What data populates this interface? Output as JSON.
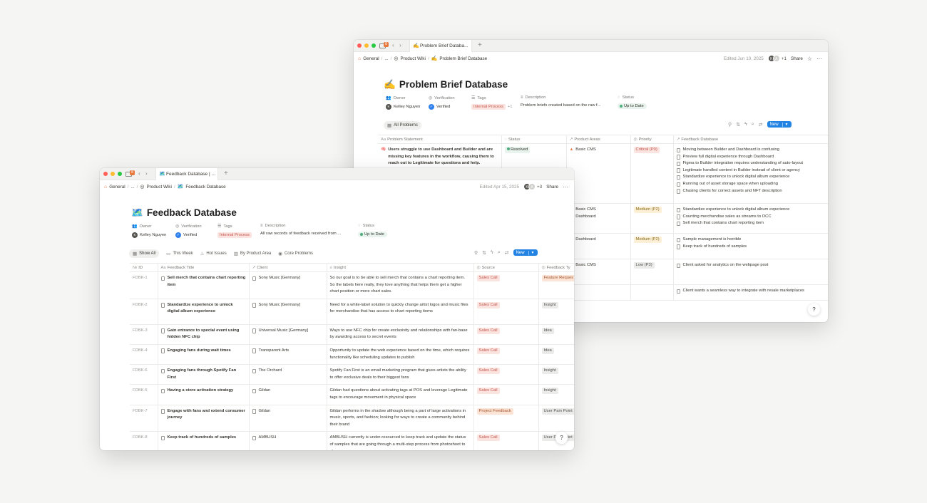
{
  "back_window": {
    "tab_title": "Problem Brief Databa...",
    "tab_icon": "✍️",
    "notification_count": "8",
    "breadcrumbs": [
      "General",
      "...",
      "Product Wiki",
      "Problem Brief Database"
    ],
    "edited": "Edited Jun 10, 2025",
    "avatars": [
      "K",
      "A"
    ],
    "avatars_more": "+1",
    "share_label": "Share",
    "page_title": "Problem Brief Database",
    "page_title_icon": "✍️",
    "properties": {
      "owner_label": "Owner",
      "owner_value": "Kelley Nguyen",
      "owner_initial": "K",
      "verification_label": "Verification",
      "verification_value": "Verified",
      "tags_label": "Tags",
      "tags_value": "Internal Process",
      "tags_more": "+1",
      "description_label": "Description",
      "description_value": "Problem briefs created based on the raw f...",
      "status_label": "Status",
      "status_value": "Up to Date"
    },
    "views": [
      "All Problems"
    ],
    "new_label": "New",
    "columns": [
      "Problem Statement",
      "Status",
      "Product Areas",
      "Priority",
      "Feedback Database"
    ],
    "rows": [
      {
        "statement": "Users struggle to use Dashboard and Builder and are missing key features in the workflow, causing them to reach out to Legitimate for questions and help.",
        "status": "Resolved",
        "areas": [
          "Basic CMS"
        ],
        "priority": "Critical (P0)",
        "feedback": [
          "Moving between Builder and Dashboard is confusing",
          "Preview full digital experience through Dashboard",
          "Figma to Builder integration requires understanding of auto-layout",
          "Legitimate handled content in Builder instead of client or agency",
          "Standardize experience to unlock digital album experience",
          "Running out of asset storage space when uploading",
          "Chasing clients for correct assets and NFT description"
        ]
      },
      {
        "statement": "",
        "status": "",
        "areas": [
          "Basic CMS",
          "Dashboard"
        ],
        "priority": "Medium (P2)",
        "feedback": [
          "Standardize experience to unlock digital album experience",
          "Counting merchandise sales as streams to OCC",
          "Sell merch that contains chart reporting item"
        ]
      },
      {
        "statement": "",
        "status": "",
        "areas": [
          "Dashboard"
        ],
        "priority": "Medium (P2)",
        "feedback": [
          "Sample management is horrible",
          "Keep track of hundreds of samples"
        ]
      },
      {
        "statement": "",
        "status": "",
        "areas": [
          "Basic CMS"
        ],
        "priority": "Low (P3)",
        "feedback": [
          "Client asked for analytics on the webpage post"
        ]
      },
      {
        "statement": "",
        "status": "",
        "areas": [],
        "priority": "",
        "feedback": [
          "Client wants a seamless way to integrate with resale marketplaces"
        ]
      }
    ]
  },
  "front_window": {
    "tab_title": "Feedback Database | ...",
    "tab_icon": "🗺️",
    "notification_count": "8",
    "breadcrumbs": [
      "General",
      "...",
      "Product Wiki",
      "Feedback Database"
    ],
    "edited": "Edited Apr 15, 2025",
    "avatars": [
      "K",
      "A"
    ],
    "avatars_more": "+3",
    "share_label": "Share",
    "page_title": "Feedback Database",
    "page_title_icon": "🗺️",
    "properties": {
      "owner_label": "Owner",
      "owner_value": "Kelley Nguyen",
      "owner_initial": "K",
      "verification_label": "Verification",
      "verification_value": "Verified",
      "tags_label": "Tags",
      "tags_value": "Internal Process",
      "description_label": "Description",
      "description_value": "All raw records of feedback received from ...",
      "status_label": "Status",
      "status_value": "Up to Date"
    },
    "views": [
      "Show All",
      "This Week",
      "Hot Issues",
      "By Product Area",
      "Core Problems"
    ],
    "new_label": "New",
    "columns": [
      "ID",
      "Feedback Title",
      "Client",
      "Insight",
      "Source",
      "Feedback Ty"
    ],
    "rows": [
      {
        "id": "FDBK-1",
        "title": "Sell merch that contains chart reporting item",
        "client": "Sony Music [Germany]",
        "insight": "So our goal is to be able to sell merch that contains a chart reporting item. So the labels here really, they love anything that helps them get a higher chart position or more chart sales.",
        "source": "Sales Call",
        "type": "Feature Reques"
      },
      {
        "id": "FDBK-2",
        "title": "Standardize experience to unlock digital album experience",
        "client": "Sony Music [Germany]",
        "insight": "Need for a white-label solution to quickly change artist logos and music files for merchandise that has access to chart reporting items",
        "source": "Sales Call",
        "type": "Insight"
      },
      {
        "id": "FDBK-3",
        "title": "Gain entrance to special event using hidden NFC chip",
        "client": "Universal Music [Germany]",
        "insight": "Ways to use NFC chip for create exclusivity and relationships with fan-base by awarding access to secret events",
        "source": "Sales Call",
        "type": "Idea"
      },
      {
        "id": "FDBK-4",
        "title": "Engaging fans during wait times",
        "client": "Transparent Arts",
        "insight": "Opportunity to update the web experience based on the time, which requires functionality like scheduling updates to publish",
        "source": "Sales Call",
        "type": "Idea"
      },
      {
        "id": "FDBK-6",
        "title": "Engaging fans through Spotify Fan First",
        "client": "The Orchard",
        "insight": "Spotify Fan First is an email marketing program that gives artists the ability to offer exclusive deals to their biggest fans",
        "source": "Sales Call",
        "type": "Insight"
      },
      {
        "id": "FDBK-5",
        "title": "Having a store activation strategy",
        "client": "Gildan",
        "insight": "Gildan had questions about activating tags at POS and leverage Legitimate tags to encourage movement in physical space",
        "source": "Sales Call",
        "type": "Insight"
      },
      {
        "id": "FDBK-7",
        "title": "Engage with fans and extend consumer journey",
        "client": "Gildan",
        "insight": "Gildan performs in the shadow although being a part of large activations in music, sports, and fashion; looking for ways to create a community behind their brand",
        "source": "Project Feedback",
        "type": "User Pain Point"
      },
      {
        "id": "FDBK-8",
        "title": "Keep track of hundreds of samples",
        "client": "AMBUSH",
        "insight": "AMBUSH currently is under-resourced to keep track and update the status of samples that are going through a multi-step process from photoshoot to showroom",
        "source": "Sales Call",
        "type": "User Pain Point"
      }
    ]
  }
}
